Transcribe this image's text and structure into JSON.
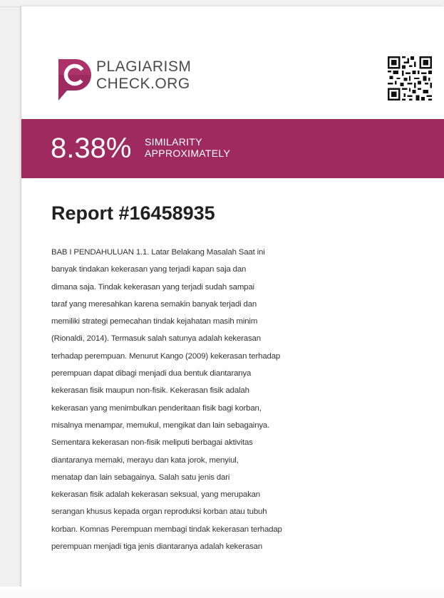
{
  "brand": {
    "line1": "PLAGIARISM",
    "line2": "CHECK.ORG",
    "logo_color": "#9e2a5f",
    "logo_letter": "C"
  },
  "banner": {
    "percent": "8.38%",
    "label1": "SIMILARITY",
    "label2": "APPROXIMATELY",
    "color": "#9e2a5f"
  },
  "report": {
    "title": "Report #16458935",
    "lines": [
      "BAB I PENDAHULUAN 1.1. Latar Belakang Masalah Saat ini",
      "banyak tindakan kekerasan yang terjadi kapan saja dan",
      "dimana saja. Tindak kekerasan yang terjadi sudah sampai",
      "taraf yang meresahkan karena semakin banyak terjadi dan",
      "memiliki strategi pemecahan tindak kejahatan masih minim",
      "(Rionaldi, 2014). Termasuk salah satunya adalah kekerasan",
      "terhadap perempuan. Menurut Kango (2009) kekerasan terhadap",
      "perempuan dapat dibagi menjadi dua bentuk diantaranya",
      "kekerasan fisik maupun non-fisik. Kekerasan fisik adalah",
      "kekerasan yang menimbulkan penderitaan fisik bagi korban,",
      "misalnya menampar, memukul, mengikat dan lain sebagainya.",
      "Sementara kekerasan non-fisik meliputi berbagai aktivitas",
      "diantaranya memaki, merayu dan kata jorok, menyiul,",
      "menatap dan lain sebagainya. Salah satu jenis dari",
      "kekerasan fisik adalah kekerasan seksual, yang merupakan",
      "serangan khusus kepada organ reproduksi korban atau tubuh",
      "korban. Komnas Perempuan membagi tindak kekerasan terhadap",
      "perempuan menjadi tiga jenis diantaranya adalah kekerasan"
    ]
  }
}
